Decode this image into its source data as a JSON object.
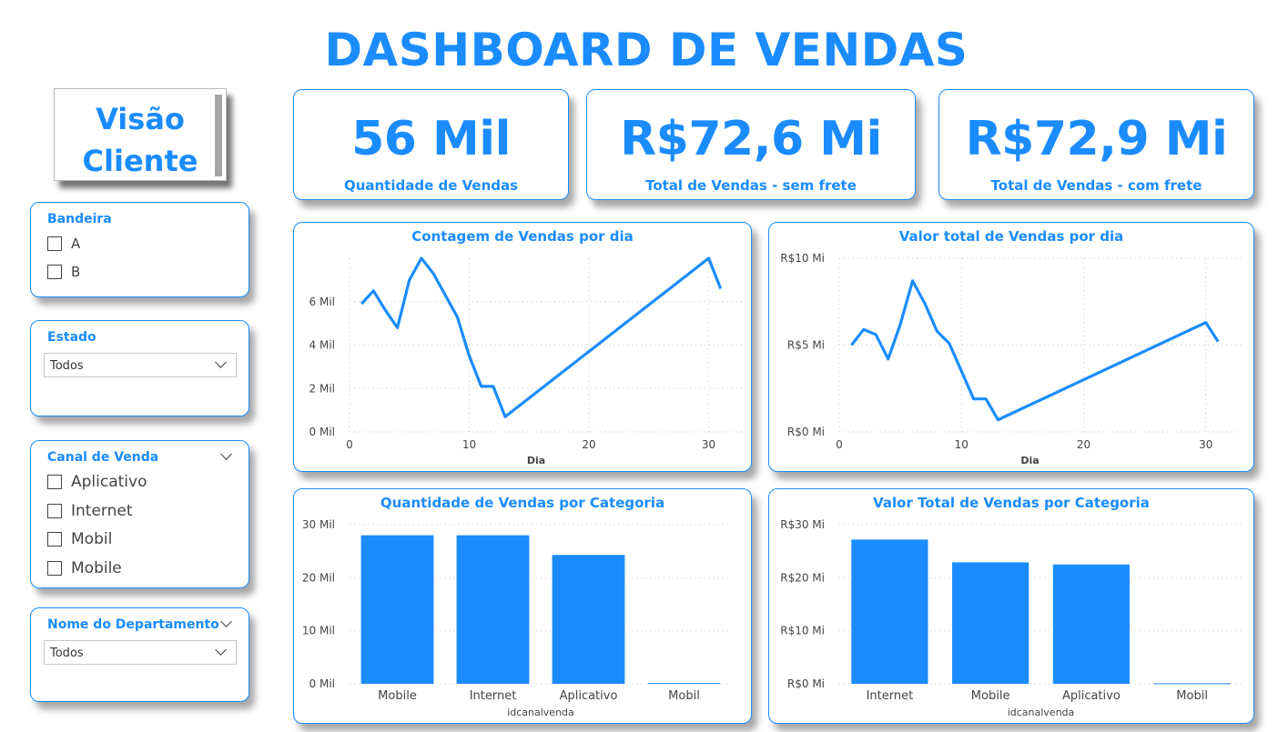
{
  "header": {
    "title": "DASHBOARD DE VENDAS"
  },
  "nav_button": {
    "line1": "Visão",
    "line2": "Cliente"
  },
  "slicers": {
    "bandeira": {
      "title": "Bandeira",
      "items": [
        "A",
        "B"
      ]
    },
    "estado": {
      "title": "Estado",
      "selected": "Todos"
    },
    "canal": {
      "title": "Canal de Venda",
      "items": [
        "Aplicativo",
        "Internet",
        "Mobil",
        "Mobile"
      ]
    },
    "departamento": {
      "title": "Nome do Departamento",
      "selected": "Todos"
    }
  },
  "kpis": [
    {
      "value": "56 Mil",
      "label": "Quantidade de Vendas"
    },
    {
      "value": "R$72,6 Mi",
      "label": "Total de Vendas - sem frete"
    },
    {
      "value": "R$72,9 Mi",
      "label": "Total de Vendas - com frete"
    }
  ],
  "colors": {
    "accent": "#1a8cff",
    "text": "#444444"
  },
  "chart_data": [
    {
      "type": "line",
      "title": "Contagem de Vendas por dia",
      "xlabel": "Dia",
      "ylabel": "",
      "x": [
        1,
        2,
        3,
        4,
        5,
        6,
        7,
        8,
        9,
        10,
        11,
        12,
        13,
        30,
        31
      ],
      "y": [
        5900,
        6500,
        5600,
        4800,
        7000,
        8000,
        7300,
        6300,
        5300,
        3500,
        2100,
        2100,
        700,
        8000,
        6600
      ],
      "xlim": [
        0,
        33
      ],
      "ylim": [
        0,
        8000
      ],
      "xticks": [
        0,
        10,
        20,
        30
      ],
      "yticks": [
        0,
        2000,
        4000,
        6000
      ],
      "ytick_labels": [
        "0 Mil",
        "2 Mil",
        "4 Mil",
        "6 Mil"
      ],
      "grid": true
    },
    {
      "type": "line",
      "title": "Valor total de Vendas por dia",
      "xlabel": "Dia",
      "ylabel": "",
      "x": [
        1,
        2,
        3,
        4,
        5,
        6,
        7,
        8,
        9,
        10,
        11,
        12,
        13,
        30,
        31
      ],
      "y": [
        5.0,
        5.9,
        5.6,
        4.2,
        6.2,
        8.7,
        7.4,
        5.8,
        5.1,
        3.5,
        1.9,
        1.9,
        0.7,
        6.3,
        5.2
      ],
      "xlim": [
        0,
        33
      ],
      "ylim": [
        0,
        10
      ],
      "xticks": [
        0,
        10,
        20,
        30
      ],
      "yticks": [
        0,
        5,
        10
      ],
      "ytick_labels": [
        "R$0 Mi",
        "R$5 Mi",
        "R$10 Mi"
      ],
      "grid": true
    },
    {
      "type": "bar",
      "title": "Quantidade de Vendas por Categoria",
      "xlabel": "idcanalvenda",
      "categories": [
        "Mobile",
        "Internet",
        "Aplicativo",
        "Mobil"
      ],
      "values": [
        28000,
        28000,
        24300,
        150
      ],
      "ylim": [
        0,
        30000
      ],
      "yticks": [
        0,
        10000,
        20000,
        30000
      ],
      "ytick_labels": [
        "0 Mil",
        "10 Mil",
        "20 Mil",
        "30 Mil"
      ],
      "grid": true
    },
    {
      "type": "bar",
      "title": "Valor Total de Vendas por Categoria",
      "xlabel": "idcanalvenda",
      "categories": [
        "Internet",
        "Mobile",
        "Aplicativo",
        "Mobil"
      ],
      "values": [
        27.2,
        22.9,
        22.5,
        0.1
      ],
      "ylim": [
        0,
        30
      ],
      "yticks": [
        0,
        10,
        20,
        30
      ],
      "ytick_labels": [
        "R$0 Mi",
        "R$10 Mi",
        "R$20 Mi",
        "R$30 Mi"
      ],
      "grid": true
    }
  ]
}
